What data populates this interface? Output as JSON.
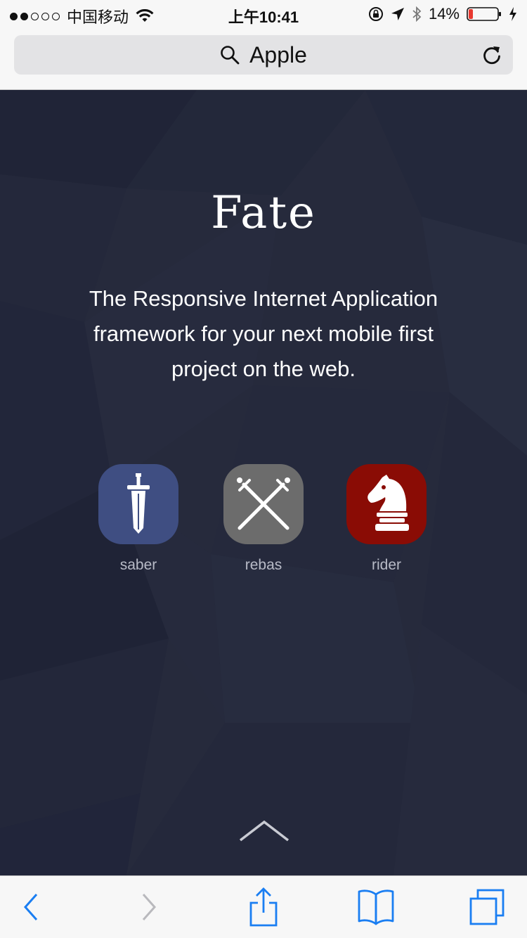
{
  "status_bar": {
    "carrier": "中国移动",
    "time": "上午10:41",
    "battery_percent": "14%",
    "battery_level": 0.14,
    "signal_bars": 2
  },
  "url_bar": {
    "text": "Apple",
    "icons": [
      "search-icon",
      "reload-icon"
    ]
  },
  "hero": {
    "title": "Fate",
    "description": "The Responsive Internet Application framework for your next mobile first project on the web.",
    "apps": [
      {
        "label": "saber",
        "icon": "sword-icon",
        "color": "#3f4e82"
      },
      {
        "label": "rebas",
        "icon": "crossed-swords-icon",
        "color": "#6c6c6c"
      },
      {
        "label": "rider",
        "icon": "chess-knight-icon",
        "color": "#8a0c05"
      }
    ],
    "scroll_icon": "chevron-up-icon",
    "background_color": "#262a3c"
  },
  "toolbar": {
    "items": [
      "back-icon",
      "forward-icon",
      "share-icon",
      "bookmarks-icon",
      "tabs-icon"
    ],
    "accent": "#1a7ef2",
    "disabled": "#b9b9bd"
  }
}
